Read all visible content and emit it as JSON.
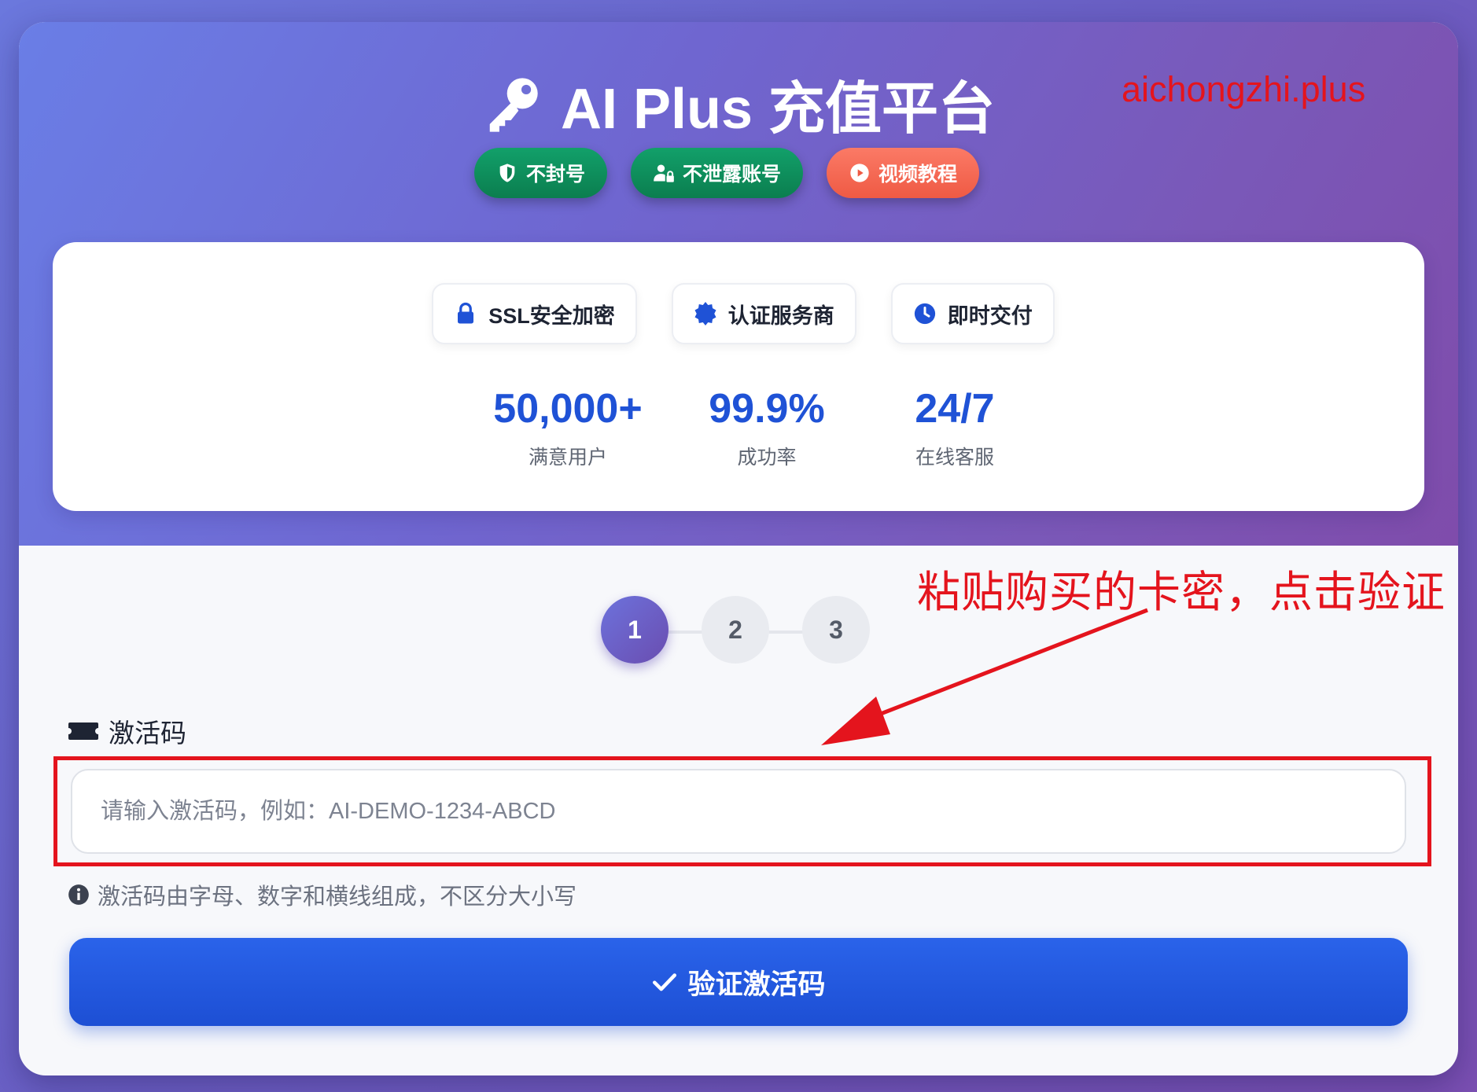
{
  "header": {
    "title": "AI Plus 充值平台",
    "watermark": "aichongzhi.plus",
    "badges": [
      {
        "label": "不封号",
        "icon": "shield-icon",
        "color": "#0b7e4f"
      },
      {
        "label": "不泄露账号",
        "icon": "user-lock-icon",
        "color": "#0b7e4f"
      },
      {
        "label": "视频教程",
        "icon": "play-circle-icon",
        "color": "#ef5a44"
      }
    ]
  },
  "trust": {
    "features": [
      {
        "label": "SSL安全加密",
        "icon": "lock-icon"
      },
      {
        "label": "认证服务商",
        "icon": "certificate-icon"
      },
      {
        "label": "即时交付",
        "icon": "clock-icon"
      }
    ],
    "stats": [
      {
        "value": "50,000+",
        "label": "满意用户"
      },
      {
        "value": "99.9%",
        "label": "成功率"
      },
      {
        "value": "24/7",
        "label": "在线客服"
      }
    ]
  },
  "annotation": "粘贴购买的卡密，点击验证",
  "steps": [
    "1",
    "2",
    "3"
  ],
  "active_step": 1,
  "form": {
    "label": "激活码",
    "placeholder": "请输入激活码，例如：AI-DEMO-1234-ABCD",
    "value": "",
    "hint": "激活码由字母、数字和横线组成，不区分大小写",
    "submit_label": "验证激活码"
  },
  "colors": {
    "accent_blue": "#1f52d6",
    "annotation_red": "#e4141d",
    "badge_green": "#0b7e4f",
    "badge_coral": "#ef5a44"
  }
}
